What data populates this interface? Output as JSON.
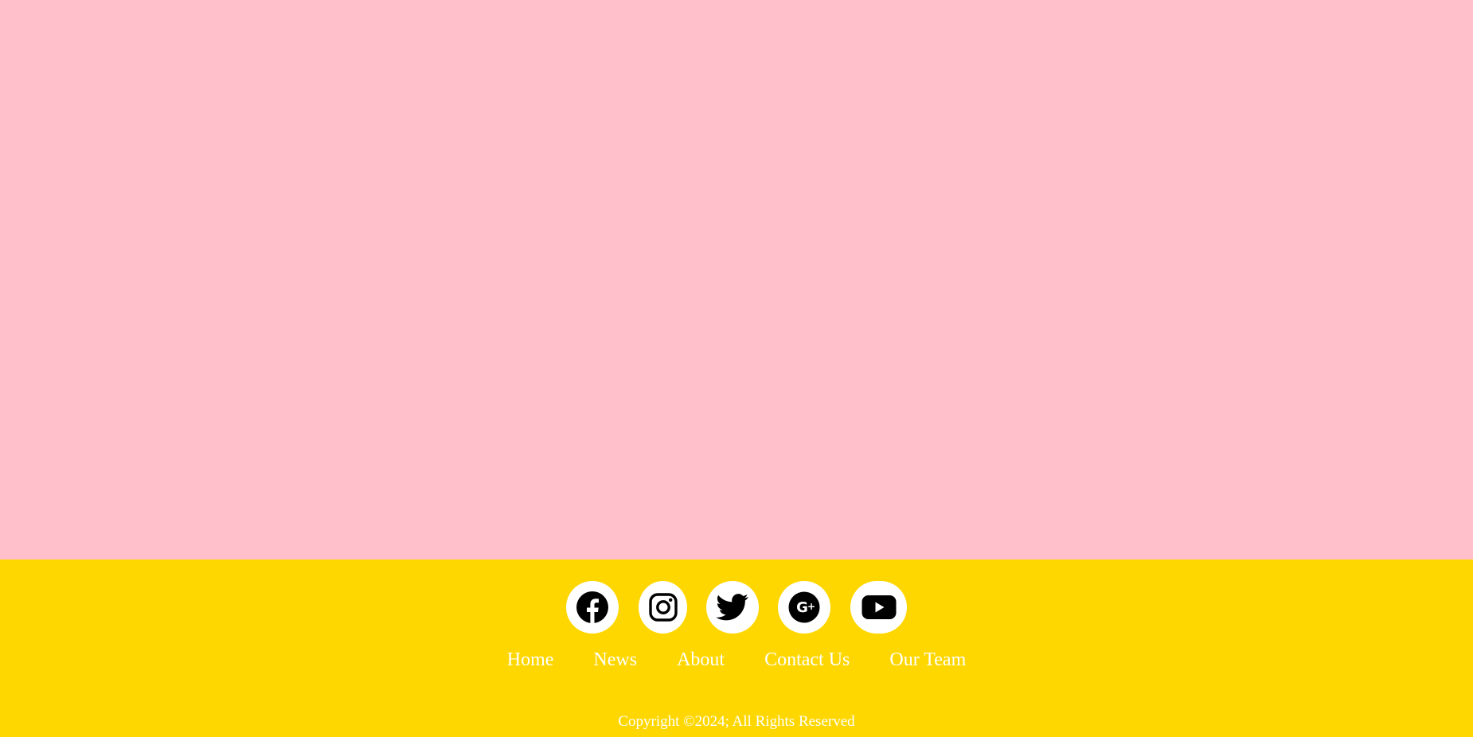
{
  "colors": {
    "hero_bg": "#ffc0cb",
    "footer_bg": "#ffd700",
    "icon_bg": "#ffffff",
    "text": "#ffffff"
  },
  "social": [
    {
      "icon": "facebook-icon"
    },
    {
      "icon": "instagram-icon"
    },
    {
      "icon": "twitter-icon"
    },
    {
      "icon": "google-plus-icon"
    },
    {
      "icon": "youtube-icon"
    }
  ],
  "nav": {
    "home": "Home",
    "news": "News",
    "about": "About",
    "contact": "Contact Us",
    "team": "Our Team"
  },
  "footer": {
    "copyright": "Copyright ©2024; All Rights Reserved"
  }
}
